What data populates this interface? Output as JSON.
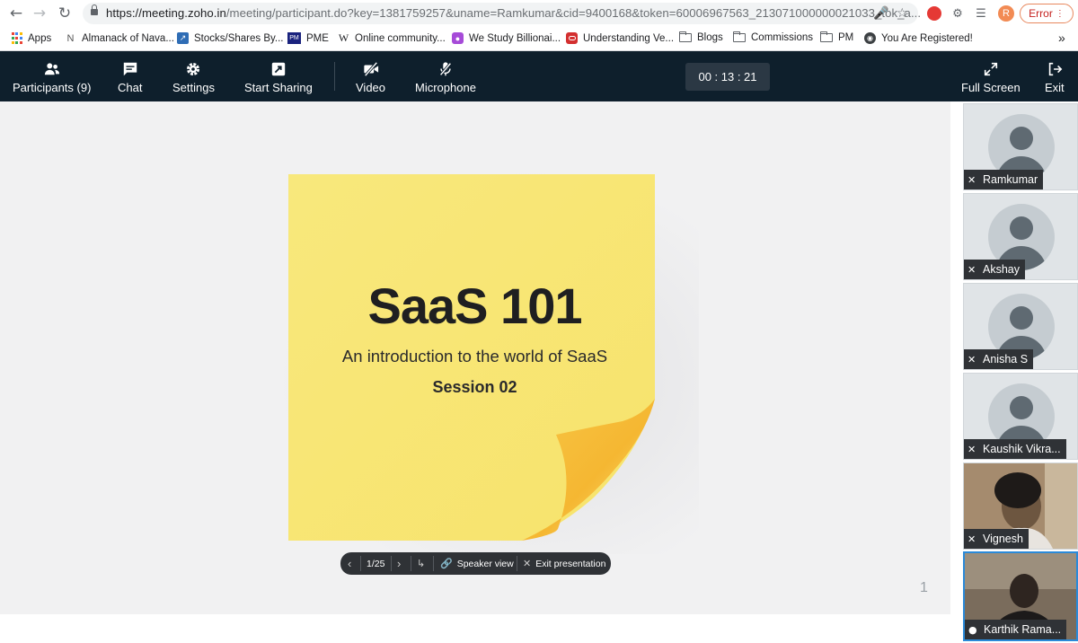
{
  "browser": {
    "url_host": "https://meeting.zoho.in",
    "url_path": "/meeting/participant.do?key=1381759257&uname=Ramkumar&cid=9400168&token=60006967563_213071000000021033_tok_a...",
    "profile_initial": "R",
    "error_label": "Error",
    "icons": [
      "back-arrow-icon",
      "forward-arrow-icon",
      "reload-icon",
      "lock-icon",
      "mic-icon",
      "star-icon",
      "extension-icon",
      "puzzle-icon",
      "reading-list-icon",
      "more-icon"
    ]
  },
  "bookmarks": {
    "items": [
      {
        "label": "Apps",
        "icon": "apps-grid-icon"
      },
      {
        "label": "Almanack of Nava...",
        "icon": "n-logo-icon"
      },
      {
        "label": "Stocks/Shares By...",
        "icon": "stocks-icon"
      },
      {
        "label": "PME",
        "icon": "pm-logo-icon"
      },
      {
        "label": "Online community...",
        "icon": "wikipedia-icon"
      },
      {
        "label": "We Study Billionai...",
        "icon": "podcast-icon"
      },
      {
        "label": "Understanding Ve...",
        "icon": "oracle-icon"
      },
      {
        "label": "Blogs",
        "icon": "folder-icon"
      },
      {
        "label": "Commissions",
        "icon": "folder-icon"
      },
      {
        "label": "PM",
        "icon": "folder-icon"
      },
      {
        "label": "You Are Registered!",
        "icon": "globe-icon"
      }
    ],
    "overflow": "»"
  },
  "toolbar": {
    "participants": "Participants (9)",
    "chat": "Chat",
    "settings": "Settings",
    "start_sharing": "Start Sharing",
    "video": "Video",
    "microphone": "Microphone",
    "timer": "00 : 13 : 21",
    "full_screen": "Full Screen",
    "exit": "Exit"
  },
  "slide": {
    "title": "SaaS 101",
    "subtitle": "An introduction to the world of SaaS",
    "session": "Session 02",
    "note_color": "#f9e97a"
  },
  "presentation_bar": {
    "page_indicator": "1/25",
    "speaker_view": "Speaker view",
    "exit_presentation": "Exit presentation"
  },
  "page_number": "1",
  "participants": [
    {
      "name": "Ramkumar",
      "muted": true,
      "video": false
    },
    {
      "name": "Akshay",
      "muted": true,
      "video": false
    },
    {
      "name": "Anisha S",
      "muted": true,
      "video": false
    },
    {
      "name": "Kaushik Vikra...",
      "muted": true,
      "video": false
    },
    {
      "name": "Vignesh",
      "muted": true,
      "video": true
    },
    {
      "name": "Karthik Rama...",
      "muted": false,
      "video": true,
      "active": true
    }
  ]
}
